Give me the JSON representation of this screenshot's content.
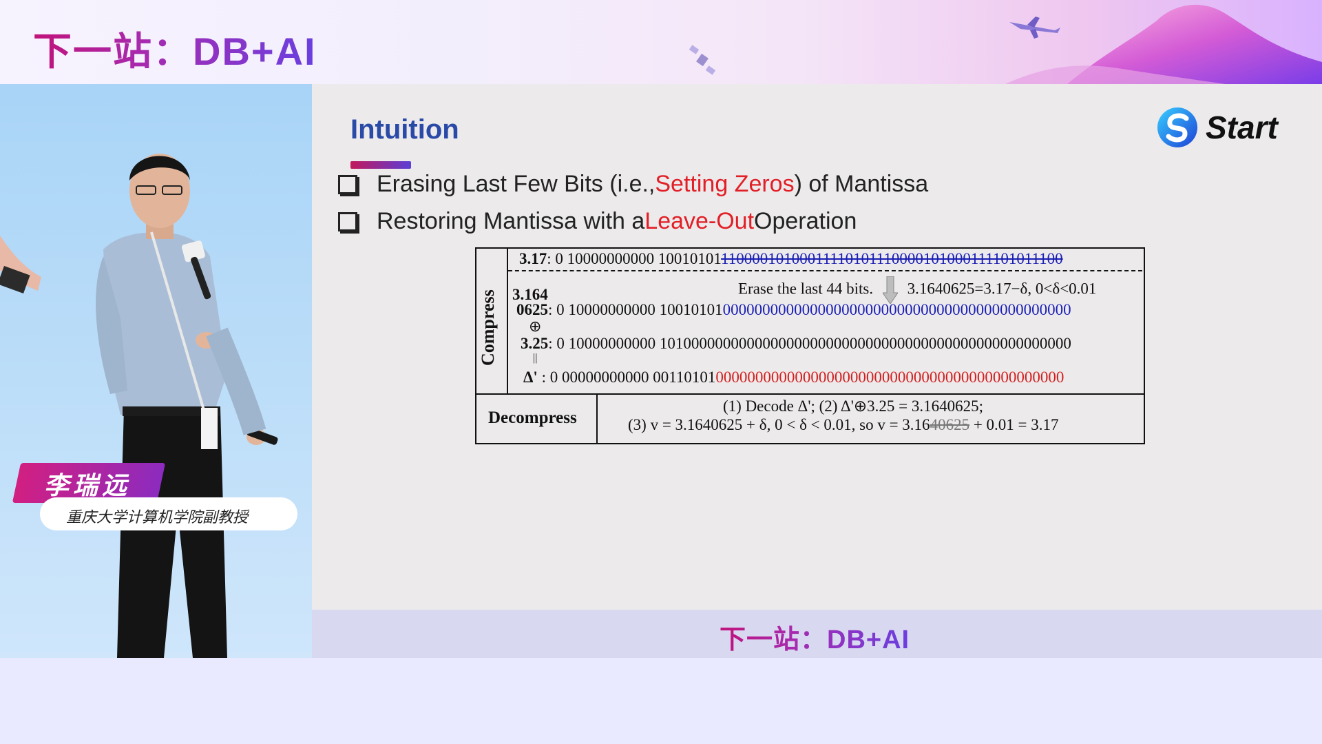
{
  "banner": {
    "title": "下一站：DB+AI"
  },
  "speaker": {
    "name": "李瑞远",
    "title": "重庆大学计算机学院副教授"
  },
  "slide": {
    "heading": "Intuition",
    "brand": "Start",
    "bullets": [
      {
        "pre": "Erasing Last Few Bits (i.e., ",
        "hl": "Setting Zeros",
        "post": ") of Mantissa"
      },
      {
        "pre": "Restoring Mantissa with a ",
        "hl": "Leave-Out",
        "post": " Operation"
      }
    ],
    "table": {
      "compress_label": "Compress",
      "decompress_label": "Decompress",
      "row1": {
        "label": "3.17",
        "prefix": ": 0 10000000000 10010101",
        "erased": "11000010100011110101110000101000111101011100"
      },
      "erase_note": "Erase the last 44 bits.",
      "erase_eq": "3.1640625=3.17−δ, 0<δ<0.01",
      "row2": {
        "label_a": "3.164",
        "label_b": "0625",
        "prefix": ": 0 10000000000 10010101",
        "zeros": "00000000000000000000000000000000000000000000"
      },
      "xor_symbol": "⊕",
      "row3": {
        "label": "3.25",
        "value": ": 0 10000000000 1010000000000000000000000000000000000000000000000000"
      },
      "eq_symbol": "||",
      "row4": {
        "label": "Δ'",
        "prefix": " : 0 00000000000 00110101",
        "zeros": "00000000000000000000000000000000000000000000"
      },
      "decomp_line1": "(1) Decode Δ'; (2) Δ'⊕3.25 = 3.1640625;",
      "decomp_line2_pre": "(3) v = 3.1640625 + δ, 0 < δ < 0.01, so v = 3.16",
      "decomp_line2_strike": "40625",
      "decomp_line2_post": " + 0.01 = 3.17"
    }
  },
  "footer": {
    "title": "下一站：DB+AI"
  },
  "colors": {
    "accent_magenta": "#c1127a",
    "accent_purple": "#6a3fe0",
    "heading_blue": "#2a4aa8",
    "highlight_red": "#e21f26"
  }
}
